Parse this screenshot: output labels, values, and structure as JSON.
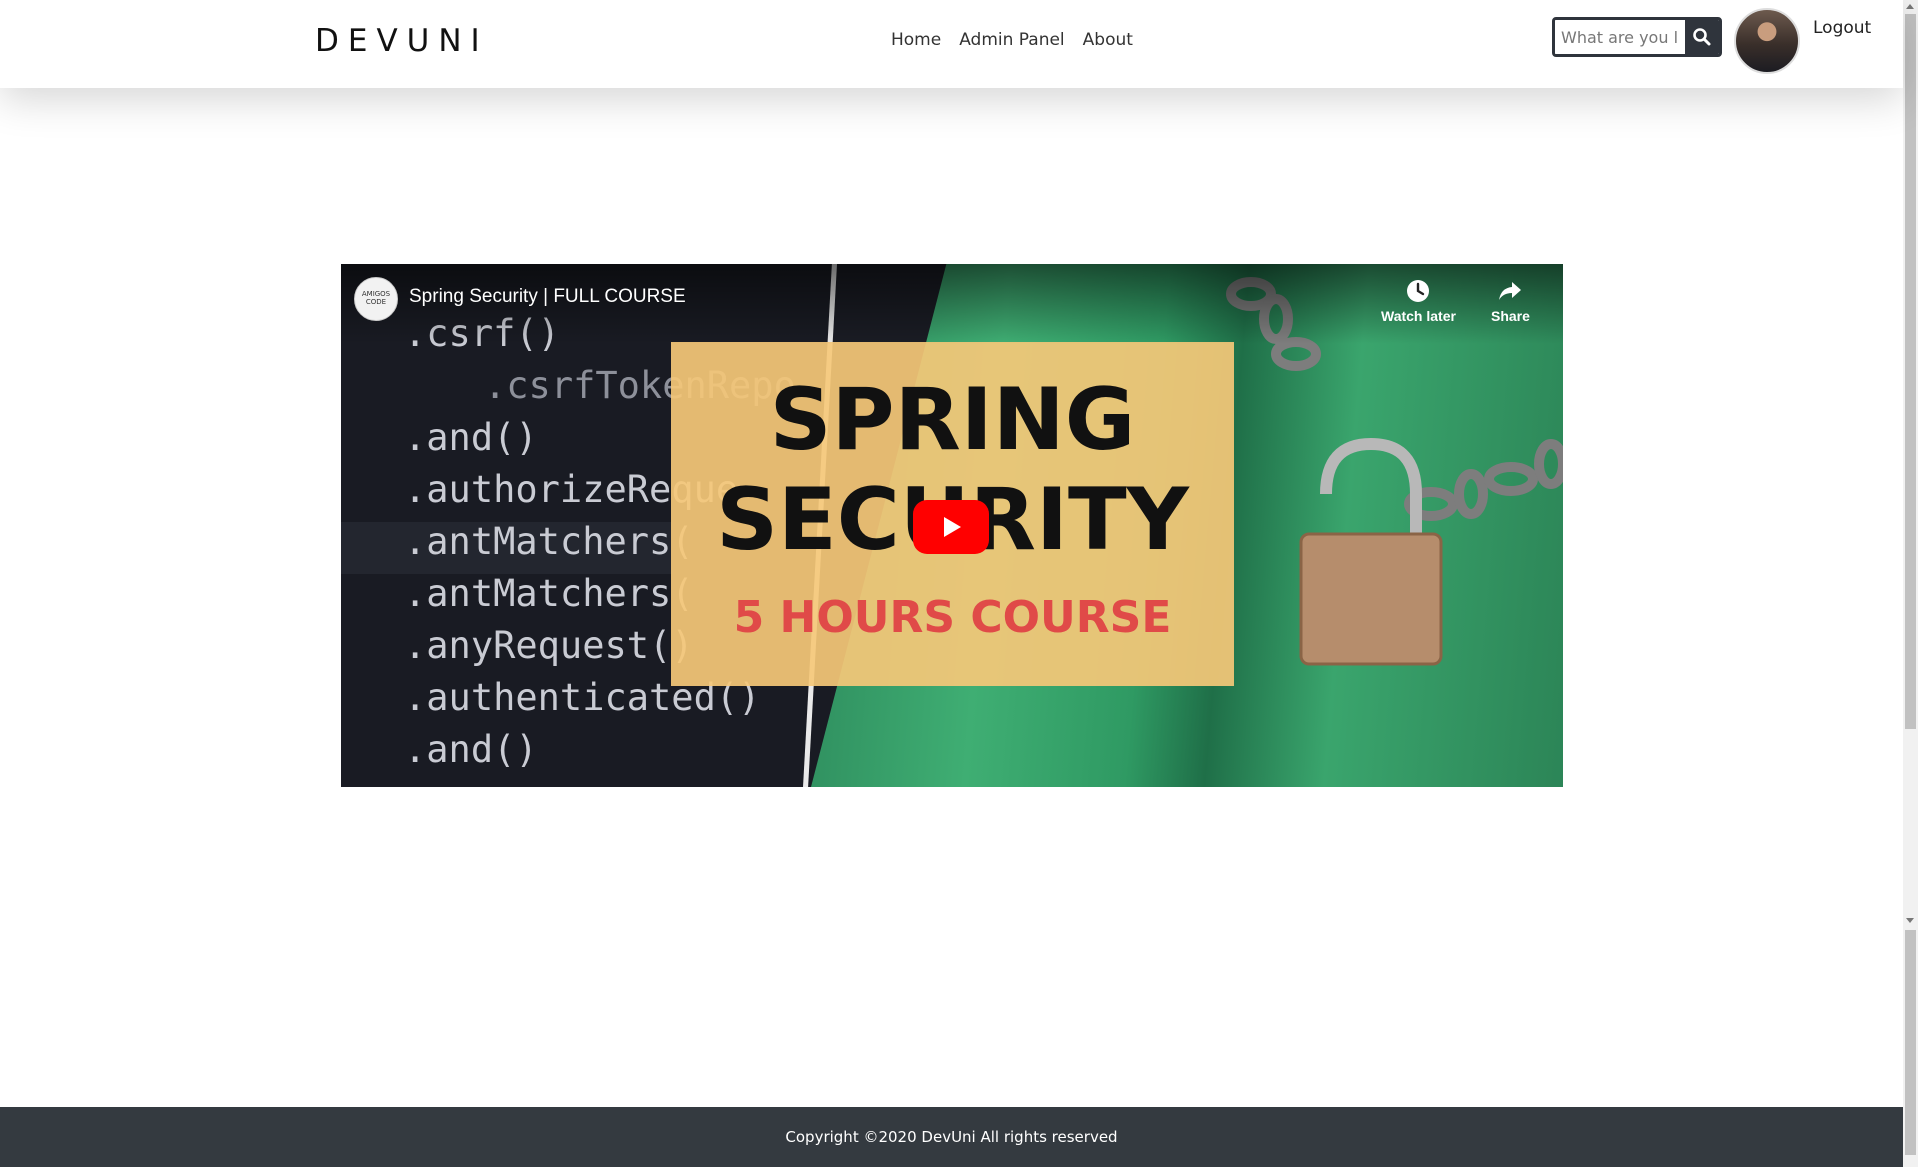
{
  "header": {
    "brand": "DEVUNI",
    "nav": [
      {
        "label": "Home"
      },
      {
        "label": "Admin Panel"
      },
      {
        "label": "About"
      }
    ],
    "search": {
      "placeholder": "What are you l",
      "icon": "search-icon"
    },
    "logout_label": "Logout"
  },
  "video": {
    "title": "Spring Security | FULL COURSE",
    "channel_logo_text": "AMIGOS CODE",
    "thumbnail": {
      "code_lines": [
        ".csrf()",
        ".csrfTokenRepo",
        ".and()",
        ".authorizeReque",
        ".antMatchers(",
        ".antMatchers(",
        ".anyRequest()",
        ".authenticated()",
        ".and()"
      ],
      "headline_1": "SPRING",
      "headline_2": "SECURITY",
      "subhead": "5 HOURS COURSE",
      "colors": {
        "panel": "#f5c878",
        "subhead": "#e04a48",
        "code_bg": "#191b23",
        "green": "#3fae73"
      }
    },
    "actions": [
      {
        "label": "Watch later",
        "icon": "clock-icon"
      },
      {
        "label": "Share",
        "icon": "share-icon"
      }
    ],
    "play_icon": "play-icon"
  },
  "footer": {
    "copyright": "Copyright ©2020 DevUni All rights reserved"
  }
}
